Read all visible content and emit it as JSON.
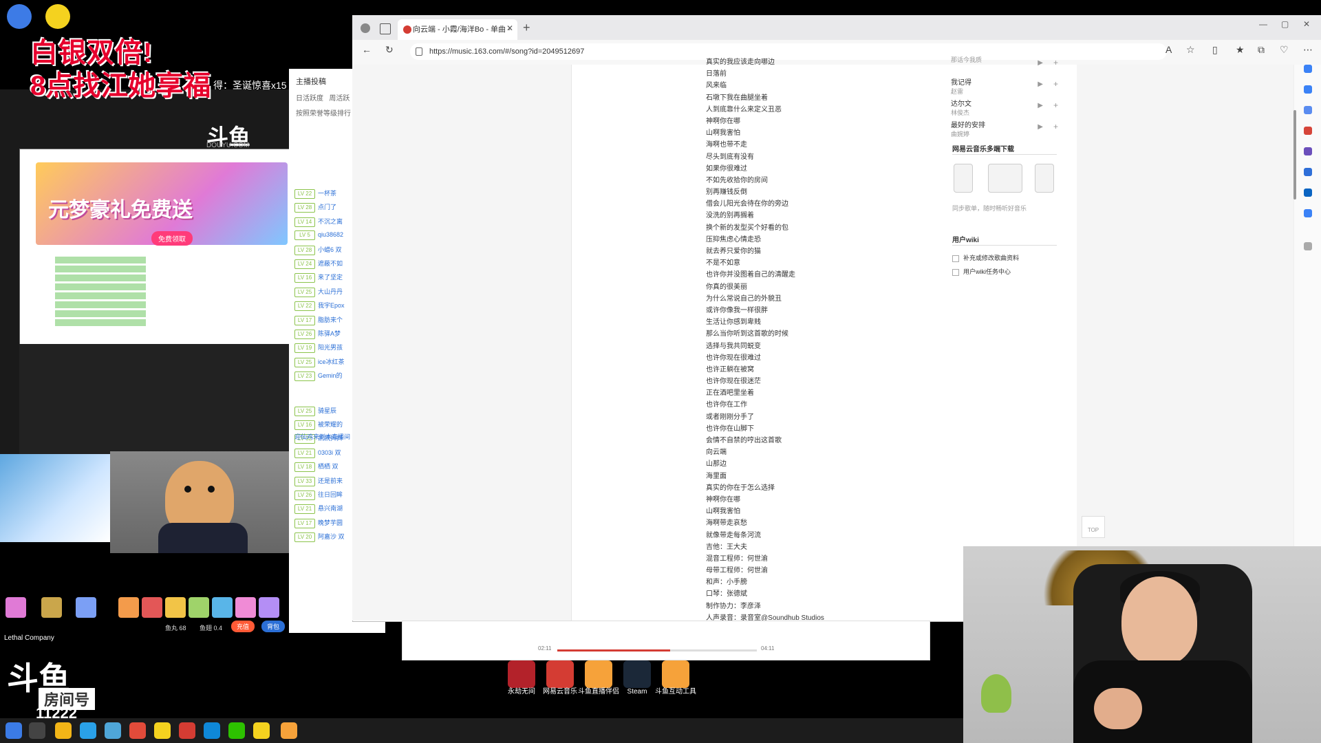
{
  "overlay": {
    "promo_title": "白银双倍!",
    "promo_sub": "8点找江她享福",
    "promo_marquee": "得：圣诞惊喜x15",
    "douyu_logo": "斗鱼",
    "douyu_url": "DOUYU.COM",
    "banner_text": "元梦豪礼免费送",
    "banner_button": "免费领取",
    "lethal_label": "Lethal Company",
    "room_logo": "斗鱼",
    "room_label": "房间号",
    "room_number": "11222"
  },
  "douyu_chat": {
    "header": "主播投稿",
    "tabs": [
      "日活跃度",
      "周活跃"
    ],
    "rank_label": "按照荣誉等级排行",
    "rows": [
      {
        "lv": "LV 22",
        "name": "一杯茶"
      },
      {
        "lv": "LV 28",
        "name": "点门了"
      },
      {
        "lv": "LV 14",
        "name": "不沉之离"
      },
      {
        "lv": "LV 5",
        "name": "qiu38682"
      },
      {
        "lv": "LV 28",
        "name": "小蜡6 双"
      },
      {
        "lv": "LV 24",
        "name": "遮蔽不如"
      },
      {
        "lv": "LV 16",
        "name": "来了坚定"
      },
      {
        "lv": "LV 25",
        "name": "大山丹丹"
      },
      {
        "lv": "LV 22",
        "name": "我宇Epox"
      },
      {
        "lv": "LV 17",
        "name": "脂肪来个"
      },
      {
        "lv": "LV 26",
        "name": "陈驿A梦"
      },
      {
        "lv": "LV 19",
        "name": "阳光男孩"
      },
      {
        "lv": "LV 25",
        "name": "ice冰红茶"
      },
      {
        "lv": "LV 23",
        "name": "Gemin的"
      },
      {
        "lv": "LV 25",
        "name": "骑星辰"
      },
      {
        "lv": "LV 16",
        "name": "被荣耀的"
      },
      {
        "lv": "LV 32",
        "name": "凯凯抖抖"
      },
      {
        "lv": "LV 21",
        "name": "0303i 双"
      },
      {
        "lv": "LV 18",
        "name": "栖栖 双"
      },
      {
        "lv": "LV 33",
        "name": "还是前来"
      },
      {
        "lv": "LV 26",
        "name": "往日回眸"
      },
      {
        "lv": "LV 21",
        "name": "悬兴南湖"
      },
      {
        "lv": "LV 17",
        "name": "晚梦芋圆"
      },
      {
        "lv": "LV 20",
        "name": "阿嘉沙 双"
      }
    ],
    "welcome": "迎仙鸡来到本直播间",
    "recharge": "充值",
    "backpack": "背包",
    "balance_fish": "鱼丸 68",
    "balance_bean": "鱼翅 0.4"
  },
  "browser": {
    "tab_title": "向云端 - 小霞/海洋Bo - 单曲 - 网易云",
    "url": "https://music.163.com/#/song?id=2049512697",
    "lyrics": [
      "真实的我应该走向哪边",
      "日落前",
      "风来临",
      "石墩下我在曲腿坐着",
      "人到底靠什么来定义丑恶",
      "神啊你在哪",
      "山啊我害怕",
      "海啊也带不走",
      "尽头到底有没有",
      "如果你很难过",
      "不如先收拾你的房间",
      "别再赚钱反倒",
      "借会儿阳光会待在你的旁边",
      "没洗的别再搁着",
      "换个新的发型买个好看的包",
      "压抑焦虑心情走恐",
      "就去养只爱你的猫",
      "不是不如意",
      "也许你并没图着自己的清醒走",
      "你真的很美丽",
      "为什么常说自己的外貌丑",
      "或许你像我一样很胖",
      "生活让你感到卑贱",
      "那么当你听到这首歌的时候",
      "选择与我共同蜕变",
      "也许你现在很难过",
      "也许正躺在被窝",
      "也许你现在很迷茫",
      "正在酒吧里坐着",
      "也许你在工作",
      "或者刚刚分手了",
      "也许你在山脚下",
      "会情不自禁的哼出这首歌",
      "向云端",
      "山那边",
      "海里面",
      "真实的你在于怎么选择",
      "神啊你在哪",
      "山啊我害怕",
      "海啊带走哀愁",
      "就像带走每条河流",
      "吉他：王大夫",
      "混音工程师：何世渝",
      "母带工程师：何世渝",
      "和声：小手膀",
      "口琴：张德斌",
      "制作协力：李彦泽",
      "人声录音：录音室@Soundhub Studios"
    ],
    "side_songs": [
      {
        "title": "",
        "artist": "那话今我质"
      },
      {
        "title": "我记得",
        "artist": "赵雷"
      },
      {
        "title": "达尔文",
        "artist": "林俊杰"
      },
      {
        "title": "最好的安排",
        "artist": "曲婉婷"
      }
    ],
    "download_title": "网易云音乐多端下载",
    "download_note": "同步歌单，随时畅听好音乐",
    "wiki_title": "用户wiki",
    "wiki_items": [
      "补充或修改歌曲资料",
      "用户wiki任务中心"
    ],
    "top_button": "TOP"
  },
  "player": {
    "time_current": "02:11",
    "time_total": "04:11",
    "progress": 0.566
  },
  "desktop": {
    "icons": [
      {
        "label": "永劫无间",
        "color": "#b3222a"
      },
      {
        "label": "网易云音乐",
        "color": "#d43c33"
      },
      {
        "label": "斗鱼直播伴侣",
        "color": "#f6a23a"
      },
      {
        "label": "Steam",
        "color": "#1b2838"
      },
      {
        "label": "斗鱼互动工具",
        "color": "#f6a23a"
      }
    ]
  },
  "colors": {
    "netease_red": "#d43c33",
    "douyu_orange": "#ff7a00",
    "promo_red": "#e6002d"
  }
}
